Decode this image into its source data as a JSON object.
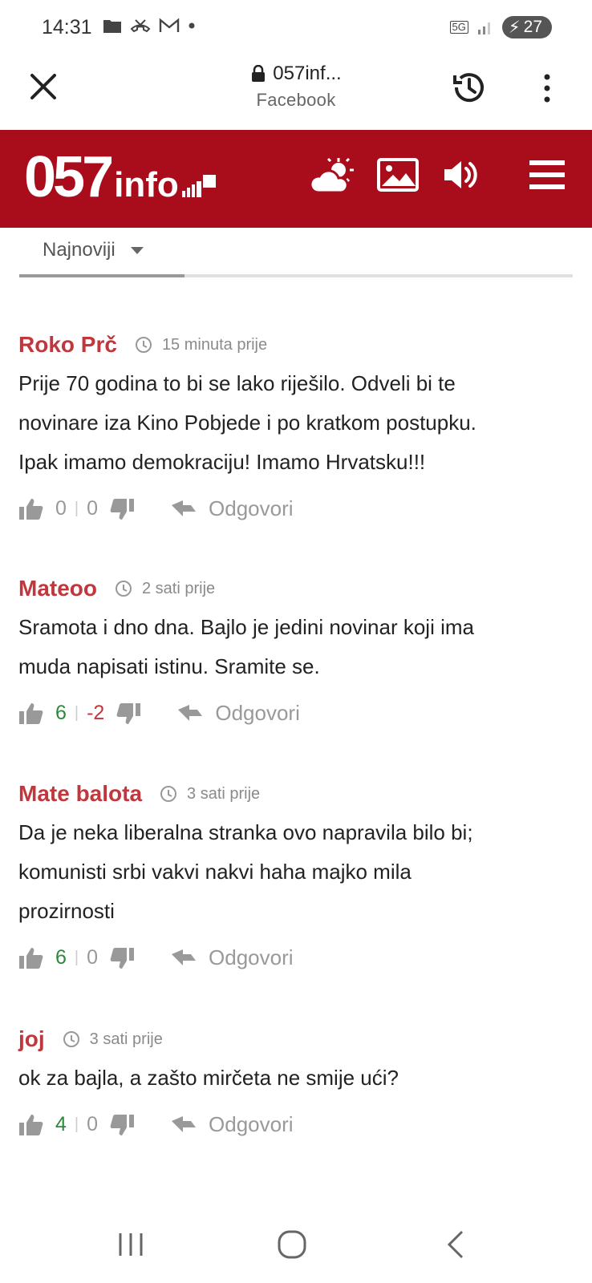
{
  "status_bar": {
    "time": "14:31",
    "network": "5G",
    "battery": "27"
  },
  "browser": {
    "url": "057inf...",
    "source": "Facebook"
  },
  "site": {
    "logo_number": "057",
    "logo_word": "info"
  },
  "sort": {
    "selected": "Najnoviji"
  },
  "reply_label": "Odgovori",
  "comments": [
    {
      "author": "Roko Prč",
      "time": "15 minuta prije",
      "lines": [
        "Prije 70 godina to bi se lako riješilo. Odveli bi te",
        "novinare iza Kino Pobjede i po kratkom postupku.",
        "Ipak imamo demokraciju! Imamo Hrvatsku!!!"
      ],
      "likes": "0",
      "dislikes": "0"
    },
    {
      "author": "Mateoo",
      "time": "2 sati prije",
      "lines": [
        "Sramota i dno dna. Bajlo je jedini novinar koji ima",
        "muda napisati istinu. Sramite se."
      ],
      "likes": "6",
      "dislikes": "-2"
    },
    {
      "author": "Mate balota",
      "time": "3 sati prije",
      "lines": [
        "Da je neka liberalna stranka ovo napravila bilo bi;",
        "komunisti srbi vakvi nakvi haha majko mila",
        "prozirnosti"
      ],
      "likes": "6",
      "dislikes": "0"
    },
    {
      "author": "joj",
      "time": "3 sati prije",
      "lines": [
        "ok za bajla, a zašto mirčeta ne smije ući?"
      ],
      "likes": "4",
      "dislikes": "0"
    }
  ],
  "colors": {
    "brand_red": "#a90d1b",
    "author_red": "#c0373d",
    "positive": "#2a8a3a"
  }
}
